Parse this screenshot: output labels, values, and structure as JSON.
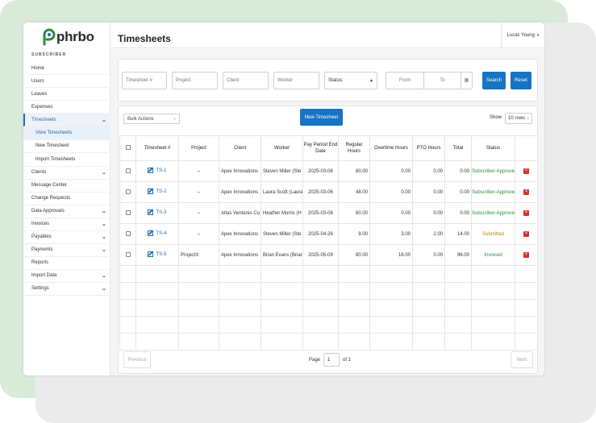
{
  "brand": {
    "logo_text": "phrbo"
  },
  "sidebar": {
    "section": "SUBSCRIBER",
    "items": [
      {
        "label": "Home"
      },
      {
        "label": "Users"
      },
      {
        "label": "Leaves"
      },
      {
        "label": "Expenses"
      },
      {
        "label": "Timesheets"
      },
      {
        "label": "View Timesheets"
      },
      {
        "label": "New Timesheet"
      },
      {
        "label": "Import Timesheets"
      },
      {
        "label": "Clients"
      },
      {
        "label": "Message Center"
      },
      {
        "label": "Change Requests"
      },
      {
        "label": "Data Approvals"
      },
      {
        "label": "Invoices"
      },
      {
        "label": "Payables"
      },
      {
        "label": "Payments"
      },
      {
        "label": "Reports"
      },
      {
        "label": "Import Data"
      },
      {
        "label": "Settings"
      }
    ]
  },
  "header": {
    "title": "Timesheets",
    "user": "Lucas Young"
  },
  "filters": {
    "timesheet_placeholder": "Timesheet #",
    "project_placeholder": "Project",
    "client_placeholder": "Client",
    "worker_placeholder": "Worker",
    "status_label": "Status:",
    "from_placeholder": "From",
    "to_placeholder": "To",
    "search_label": "Search",
    "reset_label": "Reset"
  },
  "toolbar": {
    "bulk_actions": "Bulk Actions",
    "new_timesheet": "New Timesheet",
    "show_label": "Show",
    "rows_value": "10 rows"
  },
  "table": {
    "headers": [
      "Timesheet #",
      "Project",
      "Client",
      "Worker",
      "Pay Period End Date",
      "Regular Hours",
      "Overtime Hours",
      "PTO Hours",
      "Total",
      "Status"
    ],
    "rows": [
      {
        "id": "TS-1",
        "project": "--",
        "client": "Apex Innovations",
        "worker": "Steven Miller (Ste",
        "end_date": "2025-03-06",
        "regular": "80.00",
        "overtime": "0.00",
        "pto": "0.00",
        "total": "0.00",
        "status": "Subscriber-Approve",
        "status_color": "#2e8b3a"
      },
      {
        "id": "TS-2",
        "project": "--",
        "client": "Apex Innovations",
        "worker": "Laura Scott (Laura",
        "end_date": "2025-03-06",
        "regular": "48.00",
        "overtime": "0.00",
        "pto": "0.00",
        "total": "0.00",
        "status": "Subscriber-Approve",
        "status_color": "#2e8b3a"
      },
      {
        "id": "TS-3",
        "project": "--",
        "client": "Atlas Ventures Co",
        "worker": "Heather Morris (H",
        "end_date": "2025-03-06",
        "regular": "80.00",
        "overtime": "0.00",
        "pto": "0.00",
        "total": "0.00",
        "status": "Subscriber-Approve",
        "status_color": "#2e8b3a"
      },
      {
        "id": "TS-4",
        "project": "--",
        "client": "Apex Innovations",
        "worker": "Steven Miller (Ste",
        "end_date": "2025-04-26",
        "regular": "9.00",
        "overtime": "3.00",
        "pto": "2.00",
        "total": "14.00",
        "status": "Submitted",
        "status_color": "#b8860b"
      },
      {
        "id": "TS-5",
        "project": "ProjectX",
        "client": "Apex Innovations",
        "worker": "Brian Evans (Brian",
        "end_date": "2025-05-09",
        "regular": "80.00",
        "overtime": "16.00",
        "pto": "0.00",
        "total": "96.00",
        "status": "Invoiced",
        "status_color": "#2e8b3a"
      }
    ]
  },
  "pagination": {
    "previous": "Previous",
    "page_label": "Page",
    "page_value": "1",
    "of_label": "of 1",
    "next": "Next"
  }
}
